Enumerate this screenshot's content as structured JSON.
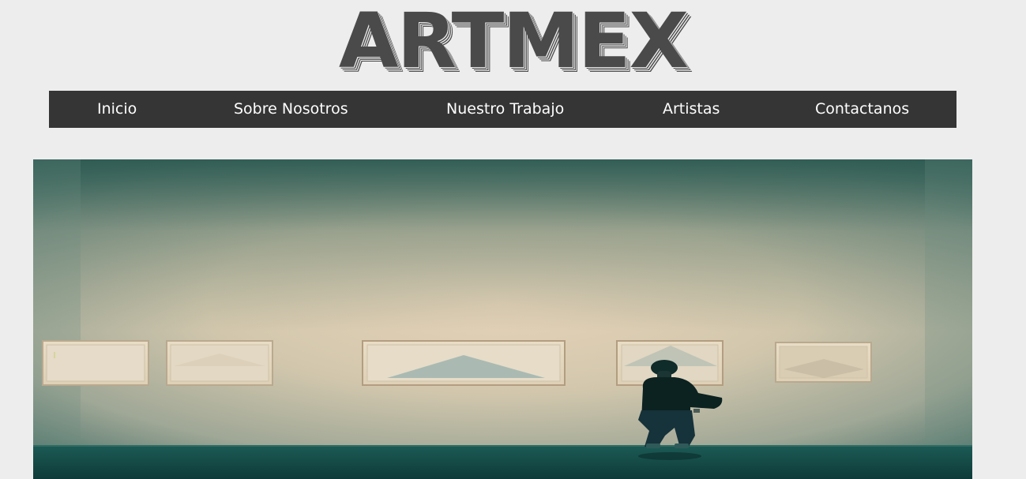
{
  "header": {
    "logo_text": "ARTMEX"
  },
  "nav": {
    "items": [
      {
        "label": "Inicio"
      },
      {
        "label": "Sobre Nosotros"
      },
      {
        "label": "Nuestro Trabajo"
      },
      {
        "label": "Artistas"
      },
      {
        "label": "Contactanos"
      }
    ]
  },
  "hero": {
    "image_subject": "gallery-photo"
  },
  "colors": {
    "background": "#ededed",
    "nav_background": "#353535",
    "nav_text": "#ffffff",
    "logo": "#4a4a4a"
  }
}
